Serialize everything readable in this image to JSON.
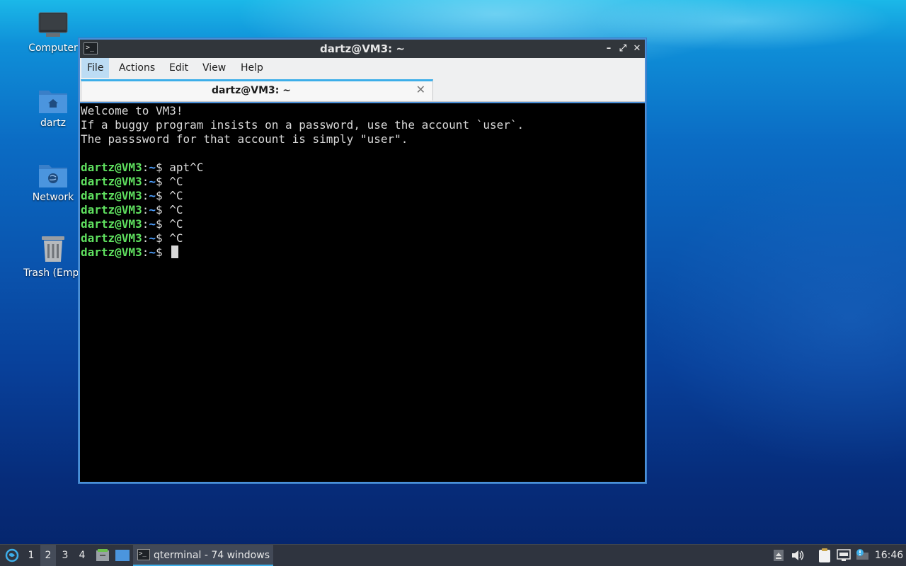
{
  "desktop": {
    "icons": [
      {
        "label": "Computer"
      },
      {
        "label": "dartz"
      },
      {
        "label": "Network"
      },
      {
        "label": "Trash (Empt"
      }
    ]
  },
  "window": {
    "title": "dartz@VM3: ~",
    "app_icon": ">_",
    "controls": {
      "minimize": "–",
      "maximize": "⤢",
      "close": "✕"
    },
    "menu": [
      "File",
      "Actions",
      "Edit",
      "View",
      "Help"
    ],
    "active_menu": "File",
    "tab": {
      "title": "dartz@VM3: ~",
      "close": "✕"
    }
  },
  "terminal": {
    "welcome": [
      "Welcome to VM3!",
      "If a buggy program insists on a password, use the account `user`.",
      "The passsword for that account is simply \"user\".",
      ""
    ],
    "prompt": {
      "user": "dartz@VM3",
      "sep": ":",
      "path": "~",
      "sym": "$ "
    },
    "commands": [
      "apt^C",
      "^C",
      "^C",
      "^C",
      "^C",
      "^C",
      ""
    ],
    "colors": {
      "user": "#5fe05f",
      "path": "#4ea0ff",
      "text": "#d8d8d8",
      "background": "#000000"
    }
  },
  "taskbar": {
    "workspaces": [
      "1",
      "2",
      "3",
      "4"
    ],
    "active_workspace": "2",
    "task": {
      "label": "qterminal - 74 windows"
    },
    "clock": "16:46"
  }
}
